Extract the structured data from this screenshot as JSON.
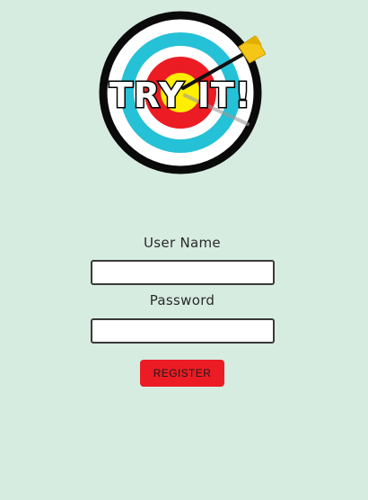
{
  "logo": {
    "text": "TRY IT!",
    "icon": "archery-target-with-arrow",
    "colors": {
      "outer_ring": "#0a0a0a",
      "cyan_ring": "#25c1d6",
      "red_ring": "#ec1c24",
      "bullseye": "#ffee00",
      "arrow_fletching": "#f5c518"
    }
  },
  "form": {
    "username_label": "User Name",
    "password_label": "Password",
    "username_value": "",
    "password_value": "",
    "register_label": "REGISTER"
  },
  "colors": {
    "background": "#d7ece1",
    "register_button": "#ec1c24"
  }
}
